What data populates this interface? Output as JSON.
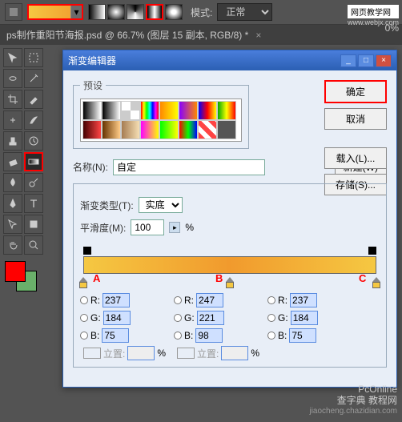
{
  "topbar": {
    "mode_label": "模式:",
    "mode_value": "正常",
    "opacity_suffix": "0%"
  },
  "watermark_top": "网页教学网",
  "watermark_top_url": "www.webjx.com",
  "tab": {
    "title": "ps制作重阳节海报.psd @ 66.7% (图层 15 副本, RGB/8) *",
    "close": "×"
  },
  "dialog": {
    "title": "渐变编辑器",
    "presets_label": "预设",
    "ok": "确定",
    "cancel": "取消",
    "load": "载入(L)...",
    "save": "存储(S)...",
    "name_label": "名称(N):",
    "name_value": "自定",
    "new_btn": "新建(W)",
    "type_label": "渐变类型(T):",
    "type_value": "实底",
    "smooth_label": "平滑度(M):",
    "smooth_value": "100",
    "smooth_pct": "%",
    "loc_label": "立置:",
    "pct": "%"
  },
  "stops": {
    "labels": [
      "A",
      "B",
      "C"
    ],
    "positions": [
      0,
      50,
      100
    ]
  },
  "rgb": [
    {
      "R": "237",
      "G": "184",
      "B": "75"
    },
    {
      "R": "247",
      "G": "221",
      "B": "98"
    },
    {
      "R": "237",
      "G": "184",
      "B": "75"
    }
  ],
  "watermark_bottom": {
    "l1": "PcOnline",
    "l2": "查字典 教程网",
    "l3": "jiaocheng.chazidian.com"
  },
  "preset_gradients": [
    "linear-gradient(90deg,#000,#fff)",
    "linear-gradient(90deg,#000,transparent)",
    "repeating-conic-gradient(#ccc 0 25%,#fff 0 50%)",
    "linear-gradient(90deg,#f00,#ff0,#0f0,#0ff,#00f,#f0f,#f00)",
    "linear-gradient(90deg,#f80,#ff0)",
    "linear-gradient(90deg,#80f,#f80)",
    "linear-gradient(90deg,#00f,#f00,#ff0)",
    "linear-gradient(90deg,#0a0,#ff0,#f00)",
    "linear-gradient(90deg,#400,#f44)",
    "linear-gradient(90deg,#630,#fc8)",
    "linear-gradient(90deg,#a67c52,#f5deb3)",
    "linear-gradient(90deg,#f0f,#ff0)",
    "linear-gradient(90deg,#0f0,#ff0)",
    "linear-gradient(90deg,#f00,#0f0,#00f)",
    "repeating-linear-gradient(45deg,#f44 0 6px,#fff 6px 12px)",
    "#555"
  ]
}
